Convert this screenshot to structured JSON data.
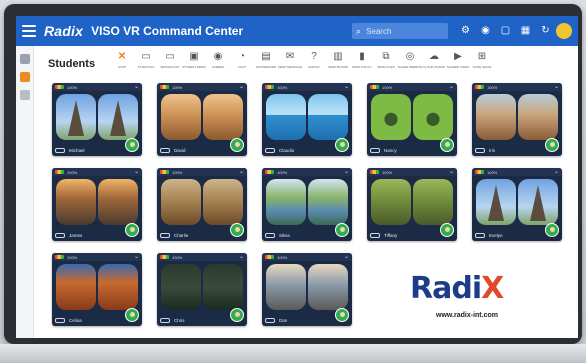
{
  "header": {
    "brand": "Radix",
    "title": "VISO VR Command Center",
    "search_placeholder": "Search"
  },
  "top_icons": [
    "user-gear-icon",
    "eye-icon",
    "window-icon",
    "grid-icon",
    "refresh-icon",
    "globe-icon"
  ],
  "page": {
    "title": "Students"
  },
  "toolbar": [
    {
      "label": "STOP",
      "icon": "✕"
    },
    {
      "label": "ATTENTION",
      "icon": "▭"
    },
    {
      "label": "BROADCAST",
      "icon": "▭"
    },
    {
      "label": "STUDENT DEMO",
      "icon": "▣"
    },
    {
      "label": "CAMERA",
      "icon": "◉"
    },
    {
      "label": "CHAT",
      "icon": "◔"
    },
    {
      "label": "WHITEBOARD",
      "icon": "▤"
    },
    {
      "label": "SEND MESSAGE",
      "icon": "✉"
    },
    {
      "label": "SURVEY",
      "icon": "?"
    },
    {
      "label": "SEND BOARD",
      "icon": "▥"
    },
    {
      "label": "SEND POLICY",
      "icon": "▮"
    },
    {
      "label": "SEND FILES",
      "icon": "⧉"
    },
    {
      "label": "SHARE WEBSITE",
      "icon": "◎"
    },
    {
      "label": "CLOUD SHARE",
      "icon": "☁"
    },
    {
      "label": "SHARED VIDEO",
      "icon": "▶"
    },
    {
      "label": "SLIDE SHOW",
      "icon": "⊞"
    }
  ],
  "students": [
    {
      "name": "Michael",
      "battery": "100%",
      "scene": "eiffel"
    },
    {
      "name": "David",
      "battery": "100%",
      "scene": "colosseum"
    },
    {
      "name": "Claudio",
      "battery": "100%",
      "scene": "beach"
    },
    {
      "name": "Nancy",
      "battery": "100%",
      "scene": "fly"
    },
    {
      "name": "Iris",
      "battery": "100%",
      "scene": "ruins"
    },
    {
      "name": "James",
      "battery": "100%",
      "scene": "city"
    },
    {
      "name": "Charlie",
      "battery": "100%",
      "scene": "lion"
    },
    {
      "name": "Silvia",
      "battery": "100%",
      "scene": "river"
    },
    {
      "name": "Tiffany",
      "battery": "100%",
      "scene": "giraffe"
    },
    {
      "name": "Evelyn",
      "battery": "100%",
      "scene": "eiffel"
    },
    {
      "name": "Celina",
      "battery": "100%",
      "scene": "canyon"
    },
    {
      "name": "Chris",
      "battery": "100%",
      "scene": "forest"
    },
    {
      "name": "Dan",
      "battery": "100%",
      "scene": "street"
    }
  ],
  "logo": {
    "main": "Radi",
    "accent": "X",
    "url": "www.radix-int.com"
  },
  "colors": {
    "topbar": "#1f63c7",
    "card": "#1c2b45",
    "accent": "#e04a2a",
    "logo": "#1d3d8a"
  }
}
